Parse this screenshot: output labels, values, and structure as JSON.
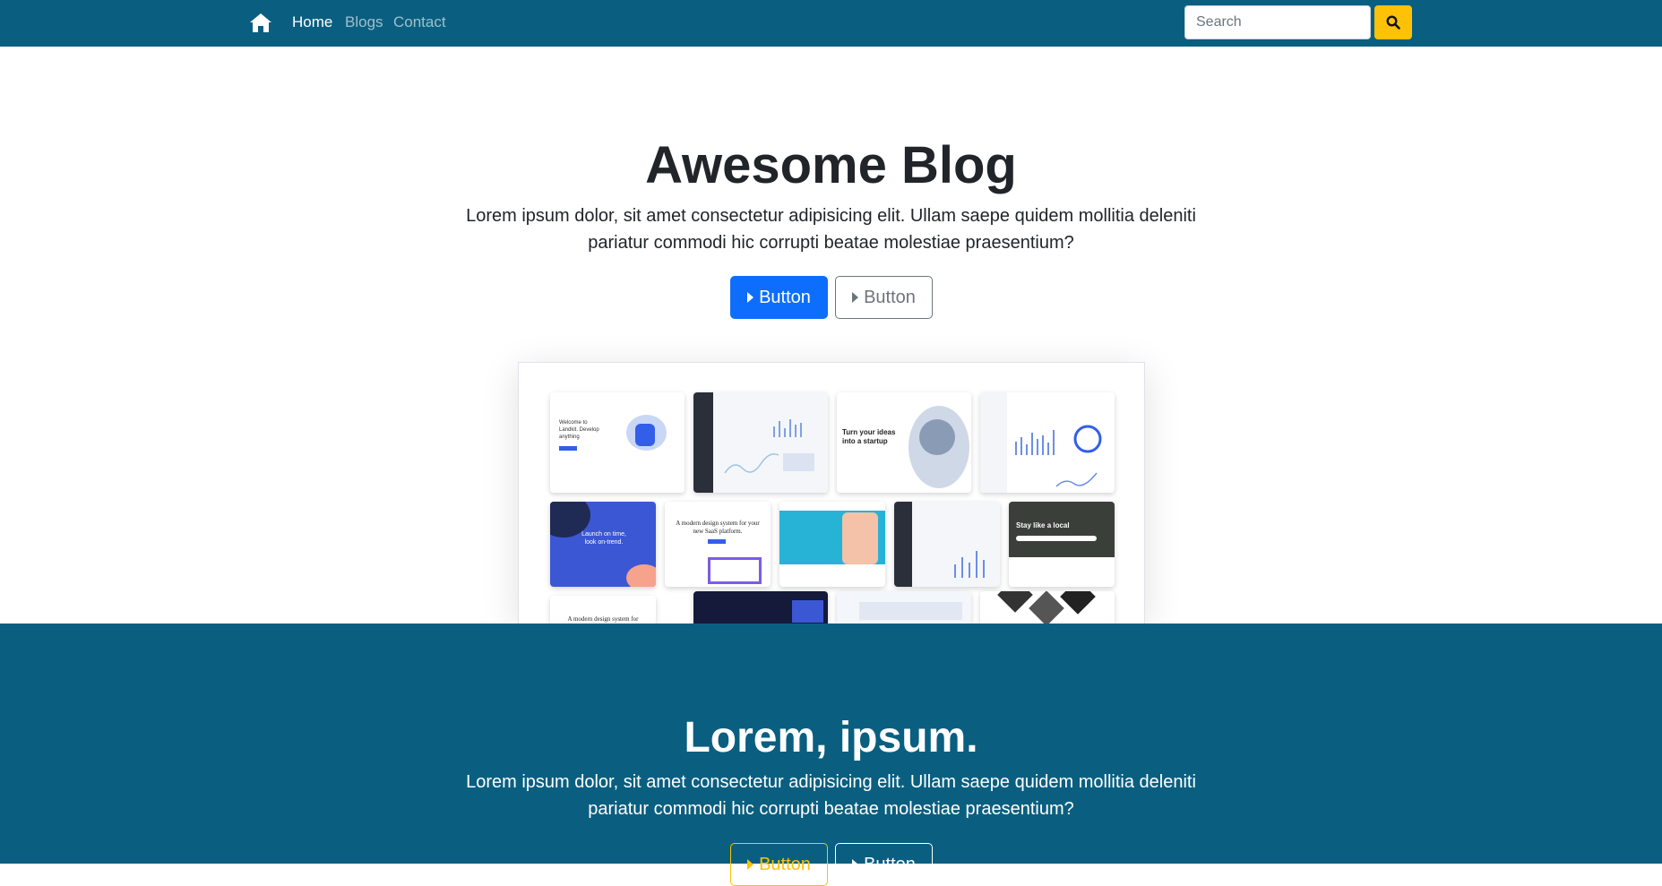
{
  "nav": {
    "home_icon": "home-icon",
    "links": [
      {
        "label": "Home",
        "active": true
      },
      {
        "label": "Blogs",
        "active": false
      },
      {
        "label": "Contact",
        "active": false
      }
    ],
    "search": {
      "placeholder": "Search",
      "value": ""
    },
    "search_button_icon": "search-icon"
  },
  "hero": {
    "title": "Awesome Blog",
    "description": "Lorem ipsum dolor, sit amet consectetur adipisicing elit. Ullam saepe quidem mollitia deleniti pariatur commodi hic corrupti beatae molestiae praesentium?",
    "primary_button": "Button",
    "secondary_button": "Button",
    "preview_alt": "collage of website template screenshots",
    "thumb_texts": {
      "landkit": "Welcome to Landkit. Develop anything",
      "startup": "Turn your ideas into a startup",
      "launch": "Launch on time, look on-trend.",
      "design": "A modern design system for your new SaaS platform.",
      "stay": "Stay like a local",
      "design2": "A modern design system for"
    }
  },
  "section2": {
    "title": "Lorem, ipsum.",
    "description": "Lorem ipsum dolor, sit amet consectetur adipisicing elit. Ullam saepe quidem mollitia deleniti pariatur commodi hic corrupti beatae molestiae praesentium?",
    "warning_button": "Button",
    "light_button": "Button"
  },
  "colors": {
    "navbar_bg": "#0a5f80",
    "primary": "#0d6efd",
    "warning": "#ffc107",
    "secondary": "#6c757d"
  }
}
